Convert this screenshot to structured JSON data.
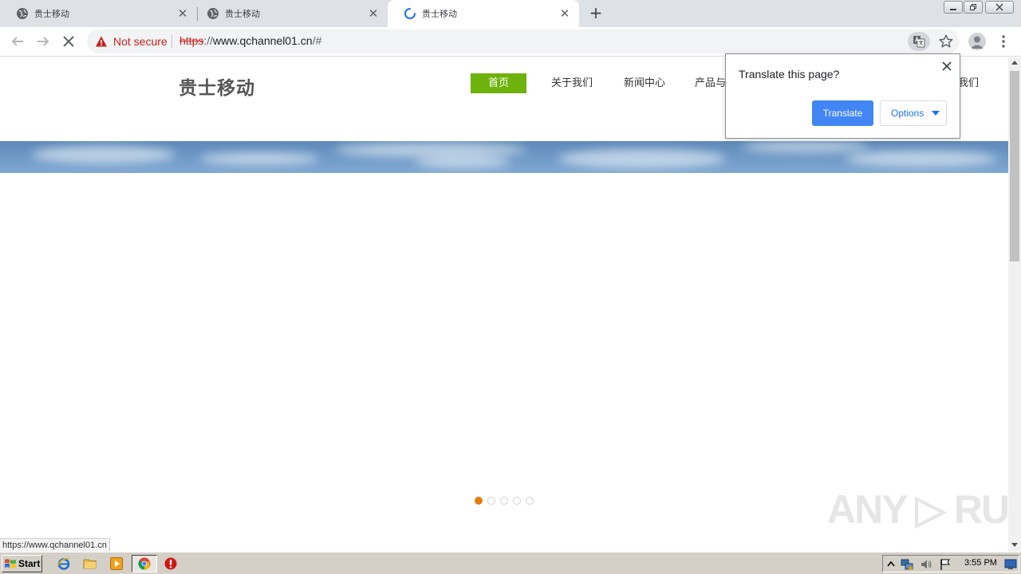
{
  "browser": {
    "tabs": [
      {
        "title": "贵士移动",
        "active": false,
        "loading": false
      },
      {
        "title": "贵士移动",
        "active": false,
        "loading": false
      },
      {
        "title": "贵士移动",
        "active": true,
        "loading": true
      }
    ],
    "new_tab_glyph": "+",
    "close_glyph": "✕",
    "security_label": "Not secure",
    "url": {
      "scheme": "https",
      "separator": "://",
      "host": "www.qchannel01.cn",
      "path": "/#"
    },
    "status_url": "https://www.qchannel01.cn"
  },
  "translate_bubble": {
    "title": "Translate this page?",
    "translate_label": "Translate",
    "options_label": "Options"
  },
  "site": {
    "logo": "贵士移动",
    "nav": [
      "首页",
      "关于我们",
      "新闻中心",
      "产品与",
      "我们"
    ],
    "nav_active_color": "#6eb20c",
    "carousel": {
      "slides": 5,
      "active": 0,
      "active_color": "#e07d10"
    }
  },
  "watermark": "ANY ▷ RUN",
  "taskbar": {
    "start_label": "Start",
    "clock": "3:55 PM"
  },
  "icons": [
    "globe-icon",
    "loading-spinner-icon",
    "back-arrow-icon",
    "forward-arrow-icon",
    "stop-icon",
    "warning-icon",
    "translate-icon",
    "star-icon",
    "profile-icon",
    "kebab-menu-icon",
    "close-icon",
    "windows-flag-icon",
    "ie-icon",
    "folder-icon",
    "media-player-icon",
    "chrome-icon",
    "stop-sign-icon",
    "tray-up-arrow-icon",
    "network-icon",
    "volume-icon",
    "flag-icon",
    "desktop-icon"
  ]
}
